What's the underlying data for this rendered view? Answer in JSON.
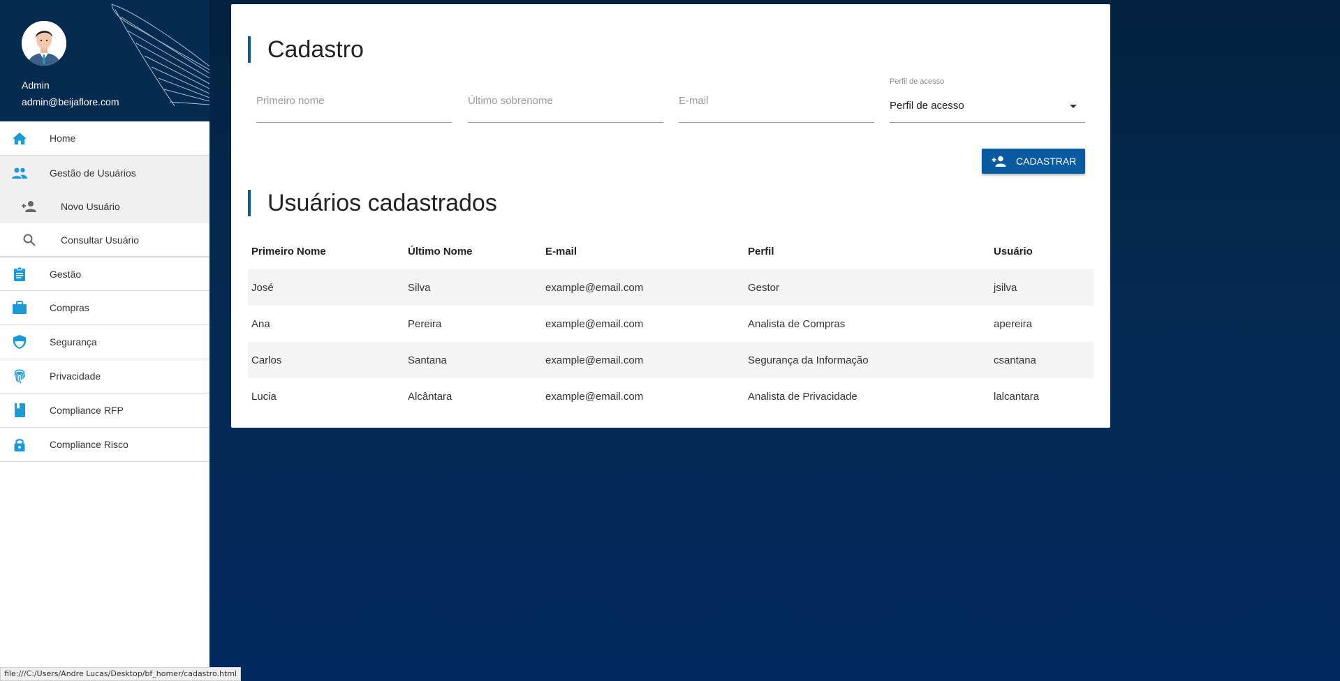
{
  "user": {
    "name": "Admin",
    "email": "admin@beijaflore.com"
  },
  "nav": {
    "home": "Home",
    "users": "Gestão de Usuários",
    "new_user": "Novo Usuário",
    "search_user": "Consultar Usuário",
    "gestao": "Gestão",
    "compras": "Compras",
    "seguranca": "Segurança",
    "privacidade": "Privacidade",
    "compliance_rfp": "Compliance RFP",
    "compliance_risco": "Compliance Risco"
  },
  "form": {
    "title": "Cadastro",
    "first_name_placeholder": "Primeiro nome",
    "last_name_placeholder": "Último sobrenome",
    "email_placeholder": "E-mail",
    "profile_label": "Perfil de acesso",
    "profile_value": "Perfil de acesso",
    "submit_label": "CADASTRAR"
  },
  "table": {
    "title": "Usuários cadastrados",
    "headers": [
      "Primeiro Nome",
      "Último Nome",
      "E-mail",
      "Perfil",
      "Usuário"
    ],
    "rows": [
      [
        "José",
        "Silva",
        "example@email.com",
        "Gestor",
        "jsilva"
      ],
      [
        "Ana",
        "Pereira",
        "example@email.com",
        "Analista de Compras",
        "apereira"
      ],
      [
        "Carlos",
        "Santana",
        "example@email.com",
        "Segurança da Informação",
        "csantana"
      ],
      [
        "Lucia",
        "Alcântara",
        "example@email.com",
        "Analista de Privacidade",
        "lalcantara"
      ]
    ]
  },
  "status_url": "file:///C:/Users/Andre Lucas/Desktop/bf_homer/cadastro.html",
  "colors": {
    "accent": "#0a5aa0",
    "icon": "#1a9ad6",
    "sidebar_header": "#052b50"
  }
}
